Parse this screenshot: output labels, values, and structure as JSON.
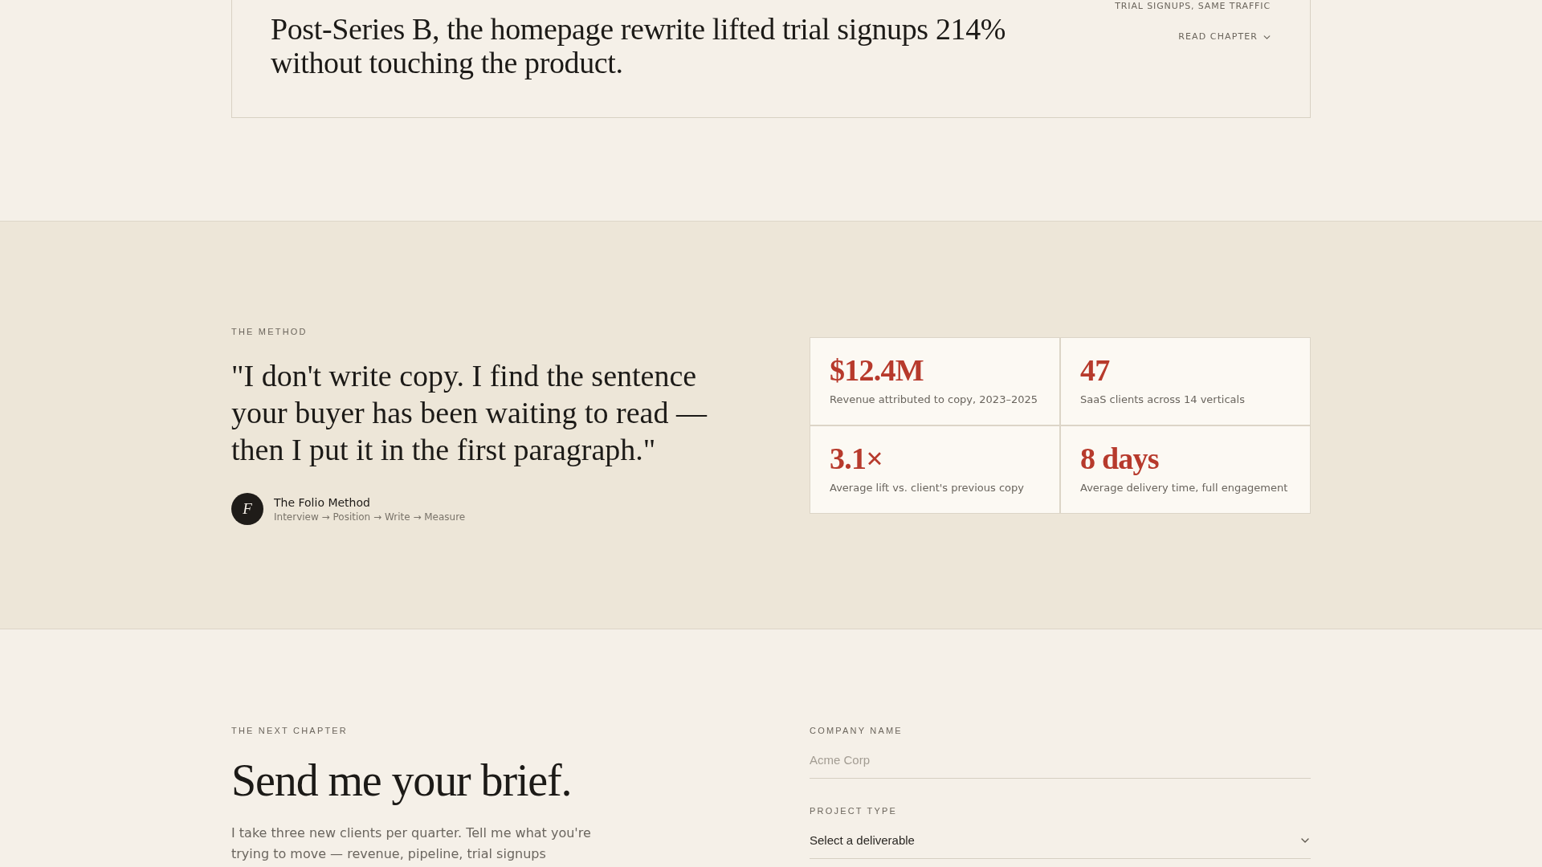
{
  "featured_chapter": {
    "headline": "Post-Series B, the homepage rewrite lifted trial signups 214% without touching the product.",
    "metric_caption": "TRIAL SIGNUPS, SAME TRAFFIC",
    "read_button": {
      "label": "READ CHAPTER"
    }
  },
  "method": {
    "eyebrow": "THE METHOD",
    "quote": "\"I don't write copy. I find the sentence your buyer has been waiting to read — then I put it in the first paragraph.\"",
    "author": {
      "initial": "F",
      "name": "The Folio Method",
      "steps": "Interview → Position → Write → Measure"
    },
    "stats": [
      {
        "value": "$12.4M",
        "label": "Revenue attributed to copy, 2023–2025"
      },
      {
        "value": "47",
        "label": "SaaS clients across 14 verticals"
      },
      {
        "value": "3.1×",
        "label": "Average lift vs. client's previous copy"
      },
      {
        "value": "8 days",
        "label": "Average delivery time, full engagement"
      }
    ]
  },
  "brief": {
    "eyebrow": "THE NEXT CHAPTER",
    "heading": "Send me your brief.",
    "intro": "I take three new clients per quarter. Tell me what you're trying to move — revenue, pipeline, trial signups",
    "form": {
      "fields": [
        {
          "kind": "text",
          "label": "COMPANY NAME",
          "placeholder": "Acme Corp"
        },
        {
          "kind": "select",
          "label": "PROJECT TYPE",
          "value": "Select a deliverable"
        }
      ]
    }
  }
}
